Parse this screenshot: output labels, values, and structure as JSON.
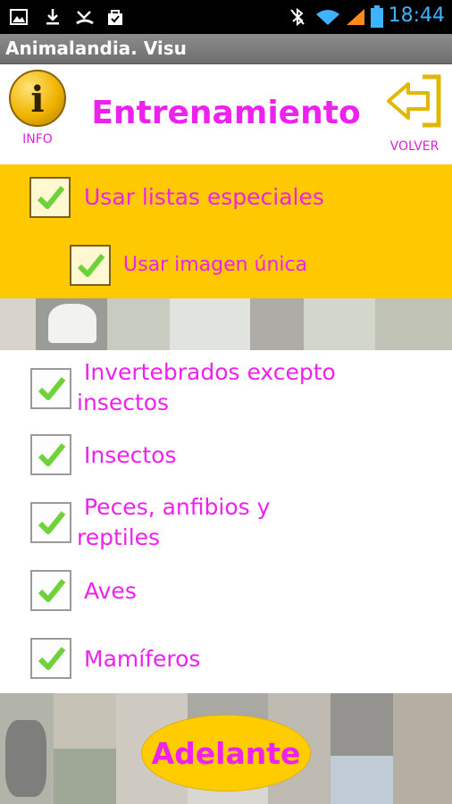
{
  "status_bar": {
    "time": "18:44",
    "icons": [
      "gallery-icon",
      "download-icon",
      "missed-call-icon",
      "bag-icon",
      "bluetooth-off-icon",
      "wifi-icon",
      "signal-icon",
      "battery-icon"
    ]
  },
  "app": {
    "title": "Animalandia. Visu"
  },
  "header": {
    "info_label": "INFO",
    "title": "Entrenamiento",
    "back_label": "VOLVER"
  },
  "special_options": [
    {
      "label": "Usar listas especiales",
      "checked": true
    },
    {
      "label": "Usar imagen única",
      "checked": true
    }
  ],
  "groups": [
    {
      "line1": "Invertebrados excepto",
      "line2": "insectos",
      "checked": true
    },
    {
      "line1": "Insectos",
      "line2": "",
      "checked": true
    },
    {
      "line1": "Peces, anfibios y",
      "line2": "reptiles",
      "checked": true
    },
    {
      "line1": "Aves",
      "line2": "",
      "checked": true
    },
    {
      "line1": "Mamíferos",
      "line2": "",
      "checked": true
    }
  ],
  "action": {
    "label": "Adelante"
  },
  "colors": {
    "accent_text": "#ee22ee",
    "panel_yellow": "#ffc900",
    "check_green": "#6fd23a"
  }
}
